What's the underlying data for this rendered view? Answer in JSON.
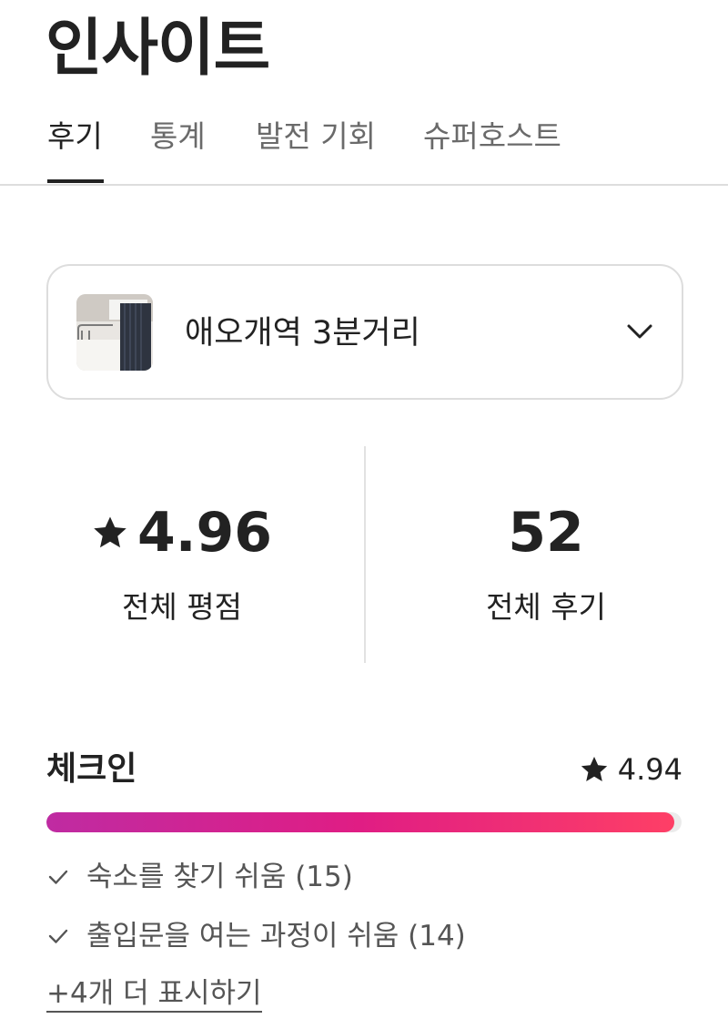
{
  "page": {
    "title": "인사이트"
  },
  "tabs": [
    {
      "label": "후기",
      "active": true
    },
    {
      "label": "통계",
      "active": false
    },
    {
      "label": "발전 기회",
      "active": false
    },
    {
      "label": "슈퍼호스트",
      "active": false
    }
  ],
  "listing": {
    "name": "애오개역 3분거리",
    "thumbnail_icon": "listing-photo",
    "dropdown_icon": "chevron-down-icon"
  },
  "stats": {
    "overall_rating": {
      "value": "4.96",
      "label": "전체 평점",
      "icon": "star-icon"
    },
    "total_reviews": {
      "value": "52",
      "label": "전체 후기"
    }
  },
  "category": {
    "title": "체크인",
    "rating": "4.94",
    "rating_fraction": 0.988,
    "gradient_colors": [
      "#bf2ba2",
      "#e01d84",
      "#fe3f66"
    ],
    "highlights": [
      {
        "text": "숙소를 찾기 쉬움 (15)",
        "icon": "check-icon"
      },
      {
        "text": "출입문을 여는 과정이 쉬움 (14)",
        "icon": "check-icon"
      }
    ],
    "more_label": "+4개 더 표시하기"
  }
}
